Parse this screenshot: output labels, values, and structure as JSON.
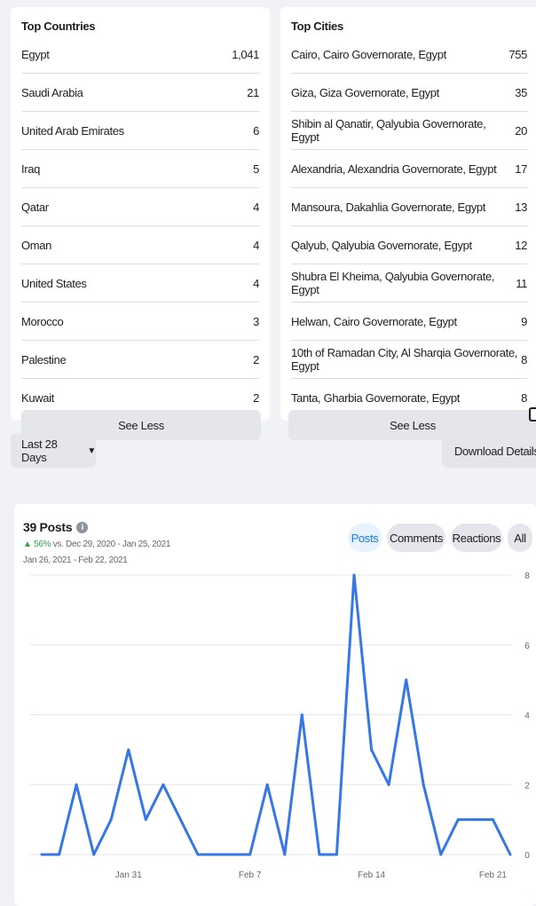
{
  "top_countries": {
    "title": "Top Countries",
    "rows": [
      {
        "name": "Egypt",
        "value": "1,041"
      },
      {
        "name": "Saudi Arabia",
        "value": "21"
      },
      {
        "name": "United Arab Emirates",
        "value": "6"
      },
      {
        "name": "Iraq",
        "value": "5"
      },
      {
        "name": "Qatar",
        "value": "4"
      },
      {
        "name": "Oman",
        "value": "4"
      },
      {
        "name": "United States",
        "value": "4"
      },
      {
        "name": "Morocco",
        "value": "3"
      },
      {
        "name": "Palestine",
        "value": "2"
      },
      {
        "name": "Kuwait",
        "value": "2"
      }
    ],
    "see_less": "See Less"
  },
  "top_cities": {
    "title": "Top Cities",
    "rows": [
      {
        "name": "Cairo, Cairo Governorate, Egypt",
        "value": "755"
      },
      {
        "name": "Giza, Giza Governorate, Egypt",
        "value": "35"
      },
      {
        "name": "Shibin al Qanatir, Qalyubia Governorate, Egypt",
        "value": "20"
      },
      {
        "name": "Alexandria, Alexandria Governorate, Egypt",
        "value": "17"
      },
      {
        "name": "Mansoura, Dakahlia Governorate, Egypt",
        "value": "13"
      },
      {
        "name": "Qalyub, Qalyubia Governorate, Egypt",
        "value": "12"
      },
      {
        "name": "Shubra El Kheima, Qalyubia Governorate, Egypt",
        "value": "11"
      },
      {
        "name": "Helwan, Cairo Governorate, Egypt",
        "value": "9"
      },
      {
        "name": "10th of Ramadan City, Al Sharqia Governorate, Egypt",
        "value": "8"
      },
      {
        "name": "Tanta, Gharbia Governorate, Egypt",
        "value": "8"
      }
    ],
    "see_less": "See Less"
  },
  "toolbar": {
    "date_range": "Last 28 Days",
    "download_label": "Download Details"
  },
  "posts_panel": {
    "title": "39 Posts",
    "change_pct": "56%",
    "change_text": "vs. Dec 29, 2020 - Jan 25, 2021",
    "date_range": "Jan 26, 2021 - Feb 22, 2021",
    "tabs": [
      "Posts",
      "Comments",
      "Reactions",
      "All"
    ],
    "active_tab": "Posts"
  },
  "colors": {
    "accent": "#1877f2",
    "line": "#3578e5",
    "positive": "#31a24c"
  },
  "chart_data": {
    "type": "line",
    "x": [
      "Jan 26",
      "Jan 27",
      "Jan 28",
      "Jan 29",
      "Jan 30",
      "Jan 31",
      "Feb 1",
      "Feb 2",
      "Feb 3",
      "Feb 4",
      "Feb 5",
      "Feb 6",
      "Feb 7",
      "Feb 8",
      "Feb 9",
      "Feb 10",
      "Feb 11",
      "Feb 12",
      "Feb 13",
      "Feb 14",
      "Feb 15",
      "Feb 16",
      "Feb 17",
      "Feb 18",
      "Feb 19",
      "Feb 20",
      "Feb 21",
      "Feb 22"
    ],
    "series": [
      {
        "values": [
          0,
          0,
          2,
          0,
          1,
          3,
          1,
          2,
          1,
          0,
          0,
          0,
          0,
          2,
          0,
          4,
          0,
          0,
          8,
          3,
          2,
          5,
          2,
          0,
          1,
          1,
          1,
          0
        ]
      }
    ],
    "x_tick_labels": [
      "Jan 31",
      "Feb 7",
      "Feb 14",
      "Feb 21"
    ],
    "y_tick_labels": [
      "0",
      "2",
      "4",
      "6",
      "8"
    ],
    "ylim": [
      0,
      8
    ],
    "grid": true
  }
}
